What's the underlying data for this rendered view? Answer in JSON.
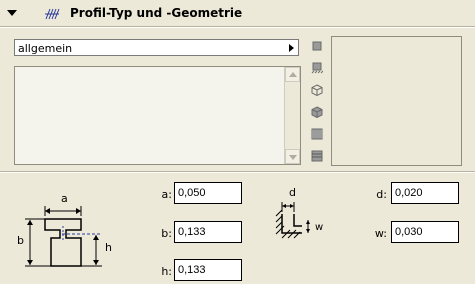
{
  "header": {
    "title": "Profil-Typ und -Geometrie"
  },
  "dropdown": {
    "value": "allgemein"
  },
  "fields": {
    "a": {
      "label": "a:",
      "value": "0,050"
    },
    "b": {
      "label": "b:",
      "value": "0,133"
    },
    "h": {
      "label": "h:",
      "value": "0,133"
    },
    "d": {
      "label": "d:",
      "value": "0,020"
    },
    "w": {
      "label": "w:",
      "value": "0,030"
    }
  },
  "diagram1": {
    "a": "a",
    "b": "b",
    "h": "h"
  },
  "diagram2": {
    "d": "d",
    "w": "w"
  },
  "icons": [
    "triangle-down",
    "profile-geometry",
    "square",
    "floor-hatch",
    "box-wire",
    "box-solid",
    "hatch-pattern",
    "grid-pattern"
  ]
}
